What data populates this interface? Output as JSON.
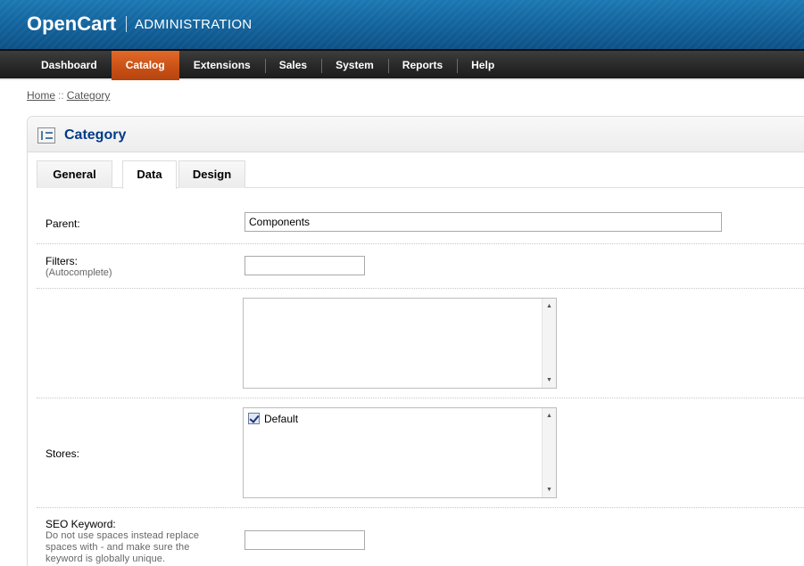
{
  "header": {
    "logo": "OpenCart",
    "subtitle": "ADMINISTRATION"
  },
  "menu": {
    "items": [
      {
        "label": "Dashboard"
      },
      {
        "label": "Catalog",
        "active": true
      },
      {
        "label": "Extensions"
      },
      {
        "label": "Sales"
      },
      {
        "label": "System"
      },
      {
        "label": "Reports"
      },
      {
        "label": "Help"
      }
    ]
  },
  "breadcrumb": {
    "home": "Home",
    "separator": "::",
    "current": "Category"
  },
  "box": {
    "title": "Category",
    "icon": "category-tree-icon"
  },
  "tabs": [
    {
      "label": "General"
    },
    {
      "label": "Data",
      "active": true
    },
    {
      "label": "Design"
    }
  ],
  "form": {
    "parent": {
      "label": "Parent:",
      "value": "Components"
    },
    "filters": {
      "label": "Filters:",
      "help": "(Autocomplete)",
      "value": ""
    },
    "stores": {
      "label": "Stores:",
      "options": [
        {
          "label": "Default",
          "checked": true
        }
      ]
    },
    "seo_keyword": {
      "label": "SEO Keyword:",
      "help": "Do not use spaces instead replace spaces with - and make sure the keyword is globally unique.",
      "value": ""
    }
  },
  "colors": {
    "header_blue": "#1466a0",
    "menu_dark": "#2a2a2a",
    "active_orange": "#c84f14",
    "title_blue": "#003a88"
  }
}
